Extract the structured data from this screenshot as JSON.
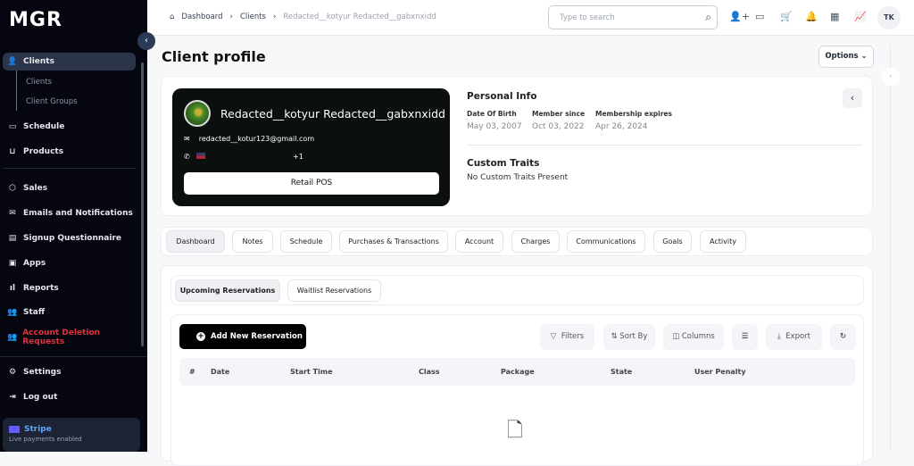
{
  "sidebar": {
    "logo": "MGR",
    "items": [
      {
        "label": "Clients",
        "icon": "user-icon"
      },
      {
        "label": "Schedule",
        "icon": "calendar-icon"
      },
      {
        "label": "Products",
        "icon": "cart-icon"
      },
      {
        "label": "Sales",
        "icon": "box-icon"
      },
      {
        "label": "Emails and Notifications",
        "icon": "mail-icon"
      },
      {
        "label": "Signup Questionnaire",
        "icon": "file-icon"
      },
      {
        "label": "Apps",
        "icon": "apps-icon"
      },
      {
        "label": "Reports",
        "icon": "bar-chart-icon"
      },
      {
        "label": "Staff",
        "icon": "users-icon"
      },
      {
        "label": "Account Deletion Requests",
        "icon": "users-icon"
      },
      {
        "label": "Settings",
        "icon": "gear-icon"
      },
      {
        "label": "Log out",
        "icon": "logout-icon"
      }
    ],
    "sub": [
      "Clients",
      "Client Groups"
    ],
    "stripe": {
      "title": "Stripe",
      "subtitle": "Live payments enabled"
    },
    "danger_color": "#e0323c"
  },
  "header": {
    "breadcrumb": [
      "Dashboard",
      "Clients",
      "Redacted__kotyur Redacted__gabxnxidd"
    ],
    "search_placeholder": "Type to search",
    "avatar": "TK"
  },
  "page": {
    "title": "Client profile",
    "options": "Options"
  },
  "client": {
    "name": "Redacted__kotyur Redacted__gabxnxidd",
    "email": "redacted__kotur123@gmail.com",
    "phone": "+1",
    "pos": "Retail POS"
  },
  "personal": {
    "title": "Personal Info",
    "dob_label": "Date Of Birth",
    "dob": "May 03, 2007",
    "since_label": "Member since",
    "since": "Oct 03, 2022",
    "exp_label": "Membership expires",
    "exp": "Apr 26, 2024",
    "traits_title": "Custom Traits",
    "traits": "No Custom Traits Present"
  },
  "tabs": [
    "Dashboard",
    "Notes",
    "Schedule",
    "Purchases & Transactions",
    "Account",
    "Charges",
    "Communications",
    "Goals",
    "Activity"
  ],
  "subtabs": [
    "Upcoming Reservations",
    "Waitlist Reservations"
  ],
  "toolbar": {
    "add": "Add New Reservation",
    "filters": "Filters",
    "sort": "Sort By",
    "columns": "Columns",
    "export": "Export"
  },
  "columns": [
    "#",
    "Date",
    "Start Time",
    "Class",
    "Package",
    "State",
    "User Penalty"
  ]
}
